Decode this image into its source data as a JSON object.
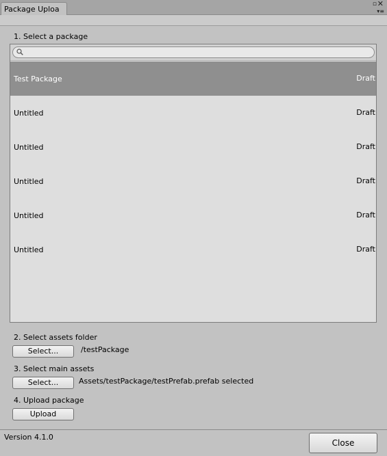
{
  "tab": {
    "title": "Package Uploa"
  },
  "window_controls": {
    "maximize": "▫",
    "close": "✕",
    "menu": "▾≡"
  },
  "step1": {
    "label": "1. Select a package"
  },
  "search": {
    "placeholder": ""
  },
  "packages": [
    {
      "name": "Test Package",
      "status": "Draft",
      "selected": true
    },
    {
      "name": "Untitled",
      "status": "Draft",
      "selected": false
    },
    {
      "name": "Untitled",
      "status": "Draft",
      "selected": false
    },
    {
      "name": "Untitled",
      "status": "Draft",
      "selected": false
    },
    {
      "name": "Untitled",
      "status": "Draft",
      "selected": false
    },
    {
      "name": "Untitled",
      "status": "Draft",
      "selected": false
    }
  ],
  "step2": {
    "label": "2. Select assets folder",
    "button": "Select...",
    "value": "/testPackage"
  },
  "step3": {
    "label": "3. Select main assets",
    "button": "Select...",
    "value": "Assets/testPackage/testPrefab.prefab selected"
  },
  "step4": {
    "label": "4. Upload package",
    "button": "Upload"
  },
  "footer": {
    "version": "Version 4.1.0",
    "close_label": "Close"
  }
}
